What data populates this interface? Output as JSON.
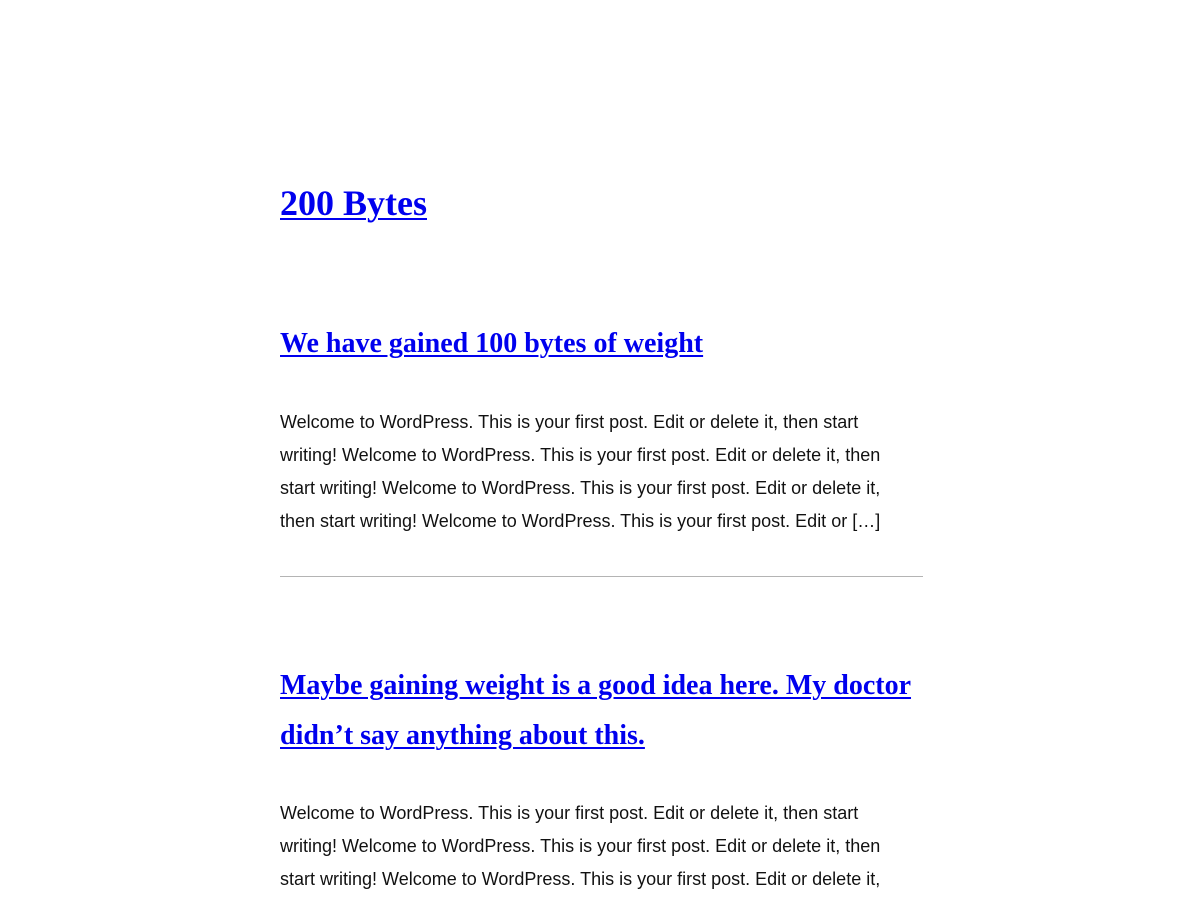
{
  "site": {
    "title": "200 Bytes"
  },
  "posts": [
    {
      "title": "We have gained 100 bytes of weight",
      "excerpt_lines": [
        "Welcome to WordPress. This is your first post. Edit or delete it, then start",
        "writing! Welcome to WordPress. This is your first post. Edit or delete it, then",
        "start writing! Welcome to WordPress. This is your first post. Edit or delete it,",
        "then start writing! Welcome to WordPress. This is your first post. Edit or […]"
      ]
    },
    {
      "title_lines": [
        "Maybe gaining weight is a good idea here. My doctor",
        "didn’t say anything about this."
      ],
      "excerpt_lines": [
        "Welcome to WordPress. This is your first post. Edit or delete it, then start",
        "writing! Welcome to WordPress. This is your first post. Edit or delete it, then",
        "start writing! Welcome to WordPress. This is your first post. Edit or delete it,"
      ]
    }
  ],
  "colors": {
    "link": "#0000ee",
    "text": "#111111",
    "separator": "#b4b4b4",
    "background": "#ffffff"
  }
}
